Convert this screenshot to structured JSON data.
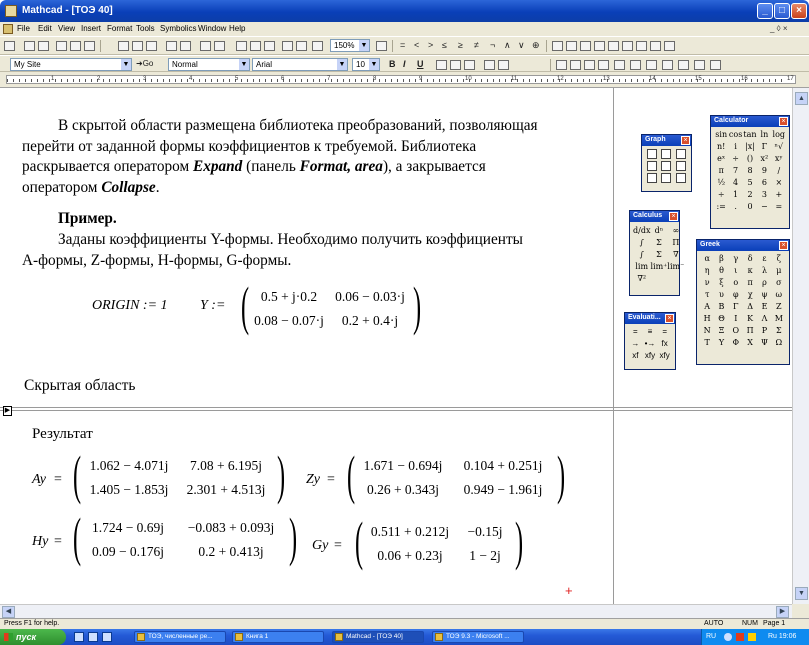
{
  "window": {
    "title": "Mathcad - [ТОЭ 40]",
    "min": "_",
    "max": "□",
    "close": "×"
  },
  "menu": {
    "items": [
      "File",
      "Edit",
      "View",
      "Insert",
      "Format",
      "Tools",
      "Symbolics",
      "Window",
      "Help"
    ],
    "doc_controls": "_ ◊ ×"
  },
  "toolbar": {
    "zoom": "150%",
    "style_combo": "My Site",
    "go_label": "Go",
    "paragraph_style": "Normal",
    "font": "Arial",
    "font_size": "10",
    "bold": "B",
    "italic": "I",
    "underline": "U"
  },
  "ruler": {
    "numbers": [
      "1",
      "2",
      "3",
      "4",
      "5",
      "6",
      "7",
      "8",
      "9",
      "10",
      "11",
      "12",
      "13",
      "14",
      "15",
      "16",
      "17"
    ]
  },
  "document": {
    "para1": [
      "В скрытой области размещена библиотека преобразований, позволяющая",
      "перейти от заданной формы коэффициентов к требуемой. Библиотека",
      "раскрывается оператором ",
      "Expand",
      " (панель ",
      "Format, area",
      "), а закрывается",
      "оператором ",
      "Collapse",
      "."
    ],
    "example_heading": "Пример.",
    "para2": [
      "Заданы коэффициенты Y-формы. Необходимо получить коэффициенты",
      "А-формы, Z-формы, H-формы, G-формы."
    ],
    "origin_expr": "ORIGIN := 1",
    "y_label": "Y :=",
    "Y": [
      [
        "0.5 + j·0.2",
        "0.06 − 0.03·j"
      ],
      [
        "0.08 − 0.07·j",
        "0.2 + 0.4·j"
      ]
    ],
    "hidden_area_label": "Скрытая область",
    "result_label": "Результат",
    "Ay_label": "Ay",
    "Ay": [
      [
        "1.062 − 4.071j",
        "7.08 + 6.195j"
      ],
      [
        "1.405 − 1.853j",
        "2.301 + 4.513j"
      ]
    ],
    "Zy_label": "Zy",
    "Zy": [
      [
        "1.671 − 0.694j",
        "0.104 + 0.251j"
      ],
      [
        "0.26 + 0.343j",
        "0.949 − 1.961j"
      ]
    ],
    "Hy_label": "Hy",
    "Hy": [
      [
        "1.724 − 0.69j",
        "−0.083 + 0.093j"
      ],
      [
        "0.09 − 0.176j",
        "0.2 + 0.413j"
      ]
    ],
    "Gy_label": "Gy",
    "Gy": [
      [
        "0.511 + 0.212j",
        "−0.15j"
      ],
      [
        "0.06 + 0.23j",
        "1 − 2j"
      ]
    ],
    "eq": "=",
    "region_marker": "▶",
    "cursor_cross": "+"
  },
  "palettes": {
    "graph": {
      "title": "Graph"
    },
    "calculus": {
      "title": "Calculus"
    },
    "evaluation": {
      "title": "Evaluati...",
      "cells": [
        "=",
        "≡",
        "=",
        "→",
        "•→",
        "fx",
        "xf",
        "xfy",
        "xfy"
      ]
    },
    "calculator": {
      "title": "Calculator",
      "cells": [
        "sin",
        "cos",
        "tan",
        "ln",
        "log",
        "n!",
        "i",
        "|x|",
        "Γ",
        "ⁿ√",
        "eˣ",
        "÷",
        "()",
        "x²",
        "xʸ",
        "π",
        "7",
        "8",
        "9",
        "/",
        "½",
        "4",
        "5",
        "6",
        "×",
        "÷",
        "1",
        "2",
        "3",
        "+",
        ":=",
        ".",
        "0",
        "−",
        "="
      ]
    },
    "greek": {
      "title": "Greek",
      "cells": [
        "α",
        "β",
        "γ",
        "δ",
        "ε",
        "ζ",
        "η",
        "θ",
        "ι",
        "κ",
        "λ",
        "μ",
        "ν",
        "ξ",
        "ο",
        "π",
        "ρ",
        "σ",
        "τ",
        "υ",
        "φ",
        "χ",
        "ψ",
        "ω",
        "Α",
        "Β",
        "Γ",
        "Δ",
        "Ε",
        "Ζ",
        "Η",
        "Θ",
        "Ι",
        "Κ",
        "Λ",
        "Μ",
        "Ν",
        "Ξ",
        "Ο",
        "Π",
        "Ρ",
        "Σ",
        "Τ",
        "Υ",
        "Φ",
        "Χ",
        "Ψ",
        "Ω"
      ]
    }
  },
  "status": {
    "help": "Press F1 for help.",
    "mode": "AUTO",
    "num": "NUM",
    "page": "Page 1"
  },
  "taskbar": {
    "start": "пуск",
    "tasks": [
      "ТОЭ, численные ре...",
      "Книга 1",
      "Mathcad - [ТОЭ 40]",
      "ТОЭ 9.3 - Microsoft ..."
    ],
    "lang": "RU",
    "clock": "Ru 19:06"
  },
  "colors": {
    "accent": "#0a3fb8",
    "crosshair": "#e02020",
    "taskbar": "#245ad6",
    "start": "#2e8e2e"
  }
}
